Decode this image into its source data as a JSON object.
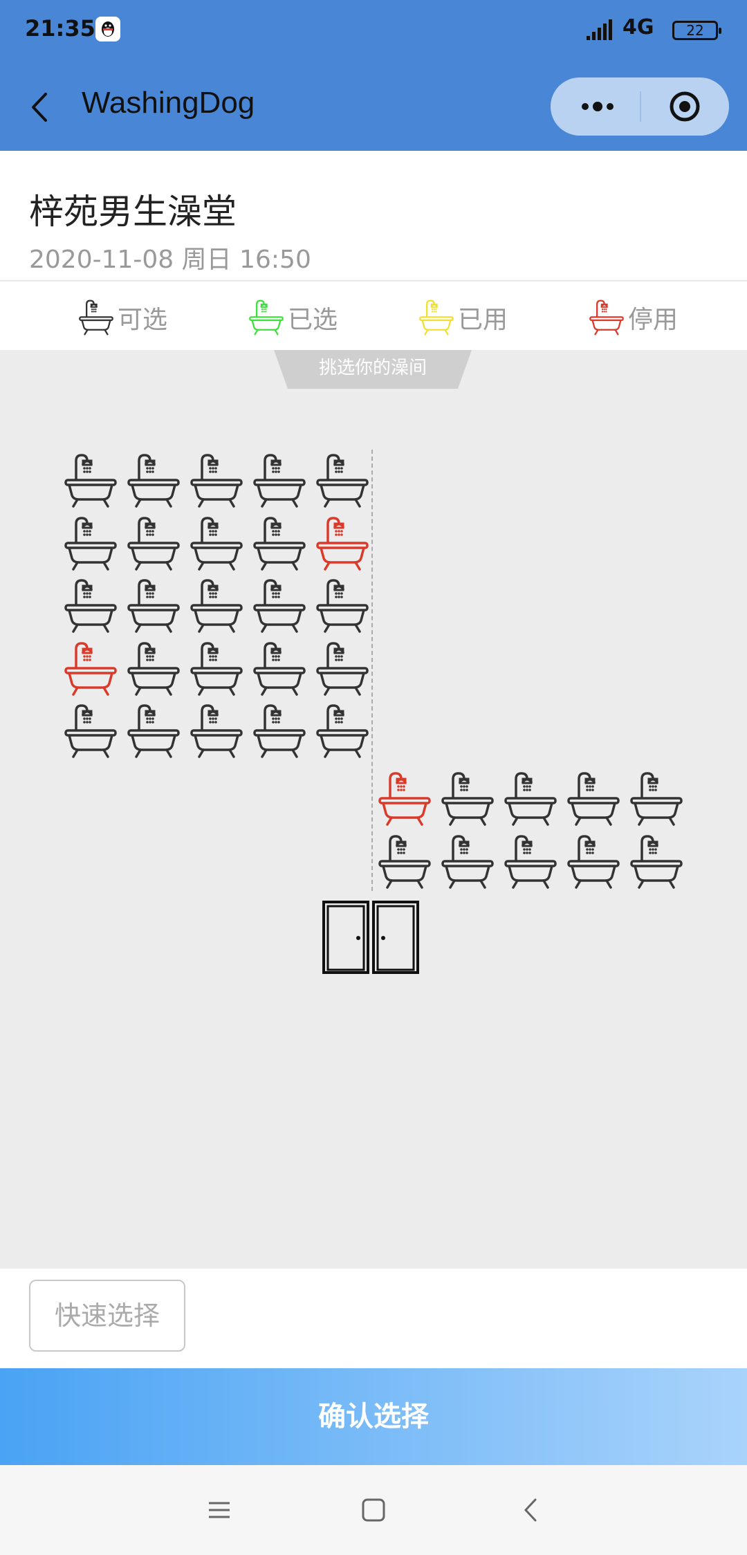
{
  "status_bar": {
    "time": "21:35",
    "network": "4G",
    "battery": "22"
  },
  "nav": {
    "title": "WashingDog"
  },
  "header": {
    "hall_name": "梓苑男生澡堂",
    "datetime": "2020-11-08 周日 16:50"
  },
  "legend": [
    {
      "label": "可选",
      "color": "#333333"
    },
    {
      "label": "已选",
      "color": "#3ee03e"
    },
    {
      "label": "已用",
      "color": "#f0e030"
    },
    {
      "label": "停用",
      "color": "#d93a2a"
    }
  ],
  "map": {
    "tab_label": "挑选你的澡间",
    "colors": {
      "available": "#333333",
      "disabled": "#d93a2a"
    },
    "left_block": [
      [
        "available",
        "available",
        "available",
        "available",
        "available"
      ],
      [
        "available",
        "available",
        "available",
        "available",
        "disabled"
      ],
      [
        "available",
        "available",
        "available",
        "available",
        "available"
      ],
      [
        "disabled",
        "available",
        "available",
        "available",
        "available"
      ],
      [
        "available",
        "available",
        "available",
        "available",
        "available"
      ]
    ],
    "right_block": [
      [
        "disabled",
        "available",
        "available",
        "available",
        "available"
      ],
      [
        "available",
        "available",
        "available",
        "available",
        "available"
      ]
    ]
  },
  "footer": {
    "quick_select": "快速选择",
    "confirm": "确认选择"
  }
}
